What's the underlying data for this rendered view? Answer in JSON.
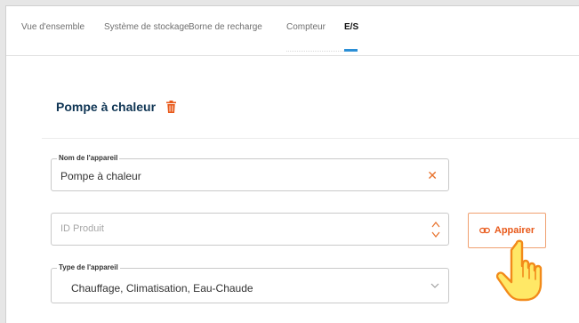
{
  "tabs": [
    {
      "label": "Vue d'ensemble"
    },
    {
      "label": "Système de stockage"
    },
    {
      "label": "Borne de recharge"
    },
    {
      "label": "Compteur"
    },
    {
      "label": "E/S"
    }
  ],
  "active_tab": "E/S",
  "device": {
    "title": "Pompe à chaleur"
  },
  "form": {
    "name": {
      "legend": "Nom de l'appareil",
      "value": "Pompe à chaleur",
      "clear_icon": "close-icon"
    },
    "product_id": {
      "placeholder": "ID Produit",
      "stepper_icon": "stepper-icon"
    },
    "type": {
      "legend": "Type de l'appareil",
      "value": "Chauffage, Climatisation, Eau-Chaude",
      "chevron_icon": "chevron-down-icon"
    },
    "pair_button": {
      "label": "Appairer",
      "icon": "link-icon"
    }
  },
  "colors": {
    "accent": "#e8591a",
    "title": "#0f3554",
    "active_tab_underline": "#2b8fd6",
    "hand_fill": "#ffe866",
    "hand_stroke": "#f28a1a"
  }
}
